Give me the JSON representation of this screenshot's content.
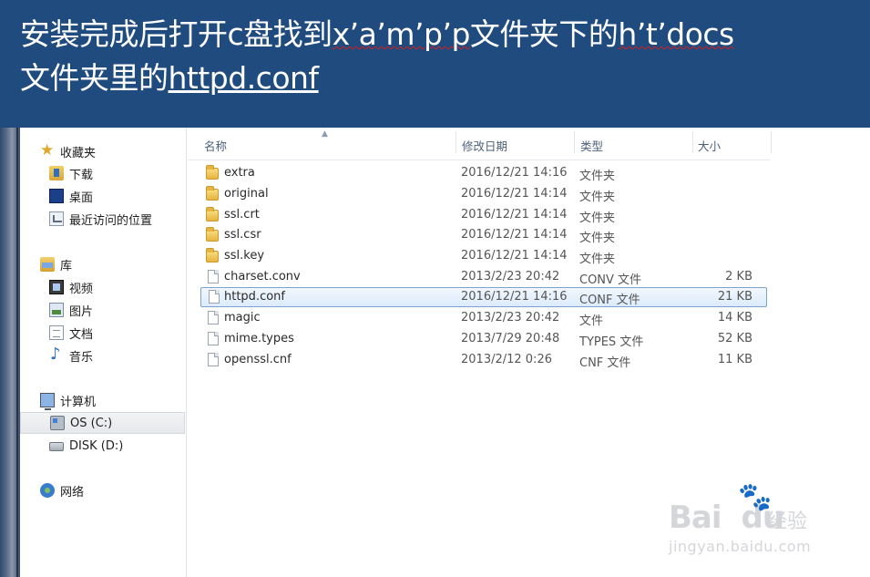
{
  "banner": {
    "line1_a": "安装完成后打开c盘找到",
    "line1_b": "x’a’m’p’p",
    "line1_c": "文件夹下的",
    "line1_d": "h’t’docs",
    "line2_a": "文件夹里的",
    "line2_b": "httpd.conf",
    "bg_color": "#1f4b7e"
  },
  "nav": {
    "favorites": {
      "label": "收藏夹",
      "icon": "star-icon"
    },
    "favorites_items": [
      {
        "label": "下载",
        "icon": "download-folder-icon"
      },
      {
        "label": "桌面",
        "icon": "desktop-icon"
      },
      {
        "label": "最近访问的位置",
        "icon": "recent-places-icon"
      }
    ],
    "library": {
      "label": "库",
      "icon": "library-icon"
    },
    "library_items": [
      {
        "label": "视频",
        "icon": "video-icon"
      },
      {
        "label": "图片",
        "icon": "picture-icon"
      },
      {
        "label": "文档",
        "icon": "document-icon"
      },
      {
        "label": "音乐",
        "icon": "music-icon"
      }
    ],
    "computer": {
      "label": "计算机",
      "icon": "computer-icon"
    },
    "computer_items": [
      {
        "label": "OS (C:)",
        "icon": "os-drive-icon",
        "selected": true
      },
      {
        "label": "DISK (D:)",
        "icon": "disk-drive-icon"
      }
    ],
    "network": {
      "label": "网络",
      "icon": "network-icon"
    }
  },
  "columns": {
    "name": "名称",
    "date": "修改日期",
    "type": "类型",
    "size": "大小"
  },
  "files": [
    {
      "name": "extra",
      "date": "2016/12/21 14:16",
      "type": "文件夹",
      "size": "",
      "kind": "folder"
    },
    {
      "name": "original",
      "date": "2016/12/21 14:14",
      "type": "文件夹",
      "size": "",
      "kind": "folder"
    },
    {
      "name": "ssl.crt",
      "date": "2016/12/21 14:14",
      "type": "文件夹",
      "size": "",
      "kind": "folder"
    },
    {
      "name": "ssl.csr",
      "date": "2016/12/21 14:14",
      "type": "文件夹",
      "size": "",
      "kind": "folder"
    },
    {
      "name": "ssl.key",
      "date": "2016/12/21 14:14",
      "type": "文件夹",
      "size": "",
      "kind": "folder"
    },
    {
      "name": "charset.conv",
      "date": "2013/2/23 20:42",
      "type": "CONV 文件",
      "size": "2 KB",
      "kind": "file"
    },
    {
      "name": "httpd.conf",
      "date": "2016/12/21 14:16",
      "type": "CONF 文件",
      "size": "21 KB",
      "kind": "file",
      "selected": true
    },
    {
      "name": "magic",
      "date": "2013/2/23 20:42",
      "type": "文件",
      "size": "14 KB",
      "kind": "file"
    },
    {
      "name": "mime.types",
      "date": "2013/7/29 20:48",
      "type": "TYPES 文件",
      "size": "52 KB",
      "kind": "file"
    },
    {
      "name": "openssl.cnf",
      "date": "2013/2/12 0:26",
      "type": "CNF 文件",
      "size": "11 KB",
      "kind": "file"
    }
  ],
  "watermark": {
    "brand": "Bai",
    "brand2": "du",
    "sub": "经验",
    "url": "jingyan.baidu.com"
  }
}
